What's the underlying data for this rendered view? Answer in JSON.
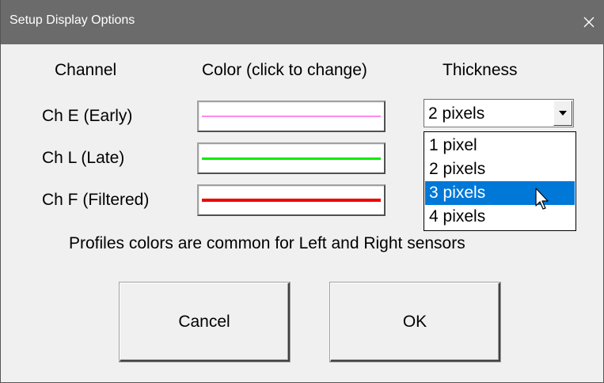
{
  "window": {
    "title": "Setup Display Options",
    "close_glyph": "✕"
  },
  "headers": {
    "channel": "Channel",
    "color": "Color (click to change)",
    "thickness": "Thickness"
  },
  "channels": [
    {
      "label": "Ch E (Early)",
      "color": "#ff88ee",
      "thickness": 2
    },
    {
      "label": "Ch L (Late)",
      "color": "#00ee00",
      "thickness": 3
    },
    {
      "label": "Ch F (Filtered)",
      "color": "#ee0000",
      "thickness": 4
    }
  ],
  "thickness_select": {
    "value": "2 pixels",
    "options": [
      "1 pixel",
      "2 pixels",
      "3 pixels",
      "4 pixels"
    ],
    "highlighted": "3 pixels"
  },
  "note": "Profiles colors are common for Left and Right sensors",
  "buttons": {
    "cancel": "Cancel",
    "ok": "OK"
  },
  "colors": {
    "titlebar": "#6b6b6b",
    "selection": "#0078d7"
  }
}
